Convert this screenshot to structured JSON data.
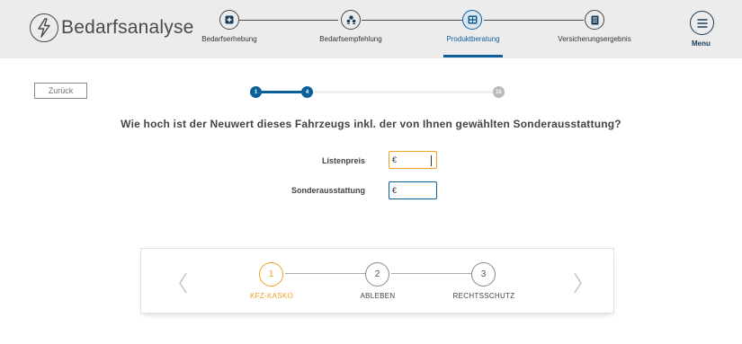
{
  "header": {
    "logo_text": "Bedarfsanalyse",
    "logo_icon": "lightning-circle-icon",
    "steps": [
      {
        "label": "Bedarfserhebung",
        "icon": "plus-square-icon",
        "active": false
      },
      {
        "label": "Bedarfsempfehlung",
        "icon": "people-icon",
        "active": false
      },
      {
        "label": "Produktberatung",
        "icon": "grid-icon",
        "active": true
      },
      {
        "label": "Versicherungsergebnis",
        "icon": "document-icon",
        "active": false
      }
    ],
    "menu_label": "Menu"
  },
  "main": {
    "back_label": "Zurück",
    "progress": {
      "current_step": "4",
      "first_step": "1",
      "total_steps": "15"
    },
    "question": "Wie hoch ist der Neuwert dieses Fahrzeugs inkl. der von Ihnen gewählten Sonderausstattung?",
    "fields": [
      {
        "label": "Listenpreis",
        "currency": "€",
        "value": "",
        "focused": true
      },
      {
        "label": "Sonderausstattung",
        "currency": "€",
        "value": "",
        "focused": false
      }
    ]
  },
  "products": {
    "steps": [
      {
        "number": "1",
        "label": "KFZ-KASKO",
        "active": true
      },
      {
        "number": "2",
        "label": "ABLEBEN",
        "active": false
      },
      {
        "number": "3",
        "label": "RECHTSSCHUTZ",
        "active": false
      }
    ],
    "prev_arrow": "〈",
    "next_arrow": "〉"
  },
  "colors": {
    "primary": "#0b5f9b",
    "accent": "#f0a020",
    "header_bg": "#ececec"
  }
}
